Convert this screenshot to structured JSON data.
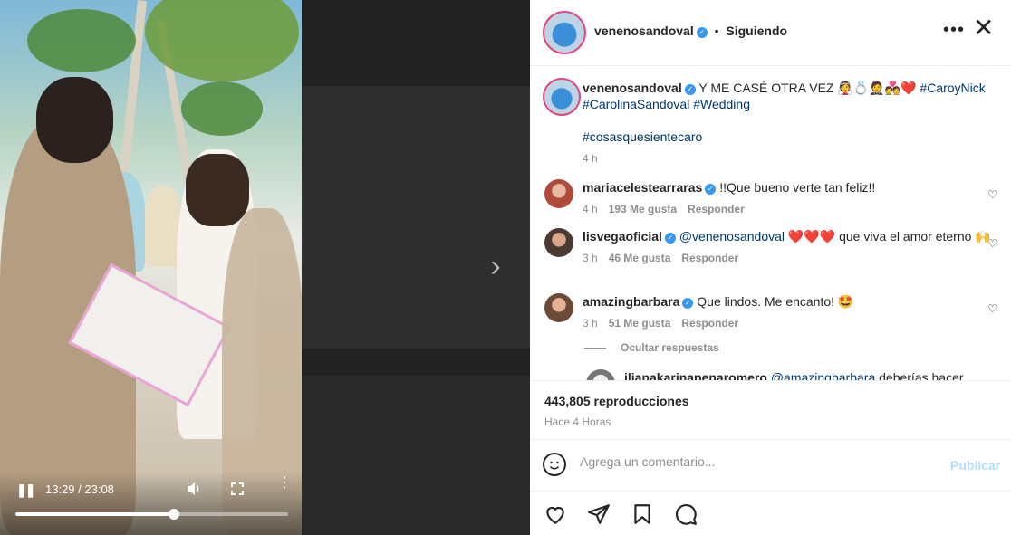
{
  "video": {
    "time": "13:29 / 23:08",
    "progress": 0.58
  },
  "header": {
    "username": "venenosandoval",
    "separator": "•",
    "following": "Siguiendo",
    "more": "•••",
    "close": "✕"
  },
  "caption": {
    "username": "venenosandoval",
    "text": "Y ME CASÉ OTRA VEZ 👰💍🤵💑❤️",
    "hashtags_line1": "#CaroyNick",
    "hashtags_line2": "#CarolinaSandoval #Wedding",
    "hashtags_line3": "#cosasquesientecaro",
    "time": "4 h"
  },
  "comments": [
    {
      "username": "mariacelestearraras",
      "text": "!!Que bueno verte tan feliz!!",
      "time": "4 h",
      "likes": "193 Me gusta",
      "reply": "Responder"
    },
    {
      "username": "lisvegaoficial",
      "mention": "@venenosandoval",
      "text": "❤️❤️❤️ que viva el amor eterno 🙌",
      "time": "3 h",
      "likes": "46 Me gusta",
      "reply": "Responder"
    },
    {
      "username": "amazingbarbara",
      "text": "Que lindos. Me encanto! 🤩",
      "time": "3 h",
      "likes": "51 Me gusta",
      "reply": "Responder"
    }
  ],
  "hide_replies": "Ocultar respuestas",
  "reply_partial": {
    "username": "ilianakarinapenaromero",
    "mention": "@amazingbarbara",
    "text": "deberías hacer"
  },
  "stats": {
    "views": "443,805 reproducciones",
    "ago": "Hace 4 Horas"
  },
  "add_comment": {
    "placeholder": "Agrega un comentario...",
    "publish": "Publicar"
  },
  "colors": {
    "link": "#00376b",
    "verified": "#3897f0",
    "publish_disabled": "#b2dffc"
  }
}
